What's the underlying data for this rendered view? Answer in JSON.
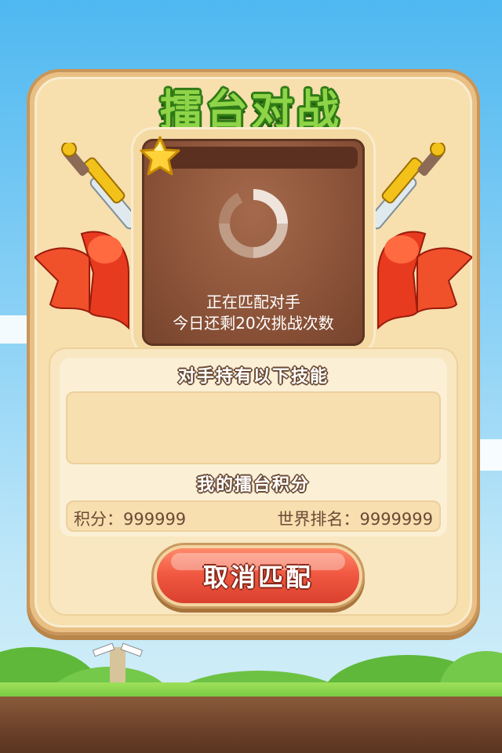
{
  "title": "擂台对战",
  "match": {
    "status_line1": "正在匹配对手",
    "status_line2": "今日还剩20次挑战次数"
  },
  "skills_section": {
    "title": "对手持有以下技能"
  },
  "score_section": {
    "title": "我的擂台积分",
    "points_label": "积分：999999",
    "rank_label": "世界排名：9999999"
  },
  "cancel_button": {
    "label": "取消匹配"
  },
  "colors": {
    "title_green": "#8fd448",
    "panel_tan": "#e9bf84",
    "match_brown": "#8a5238",
    "button_red": "#f25a43"
  },
  "icons": [
    "star-icon",
    "loading-spinner-icon",
    "sword-icon",
    "ribbon-icon"
  ]
}
